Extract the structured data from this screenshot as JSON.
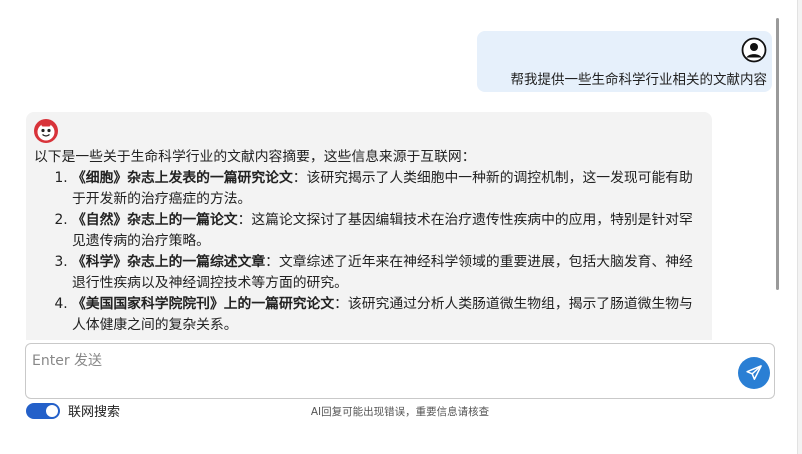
{
  "conversation": {
    "user_message": "帮我提供一些生命科学行业相关的文献内容",
    "bot_intro": "以下是一些关于生命科学行业的文献内容摘要，这些信息来源于互联网：",
    "bot_items": [
      {
        "title": "《细胞》杂志上发表的一篇研究论文",
        "text": "：该研究揭示了人类细胞中一种新的调控机制，这一发现可能有助于开发新的治疗癌症的方法。"
      },
      {
        "title": "《自然》杂志上的一篇论文",
        "text": "：这篇论文探讨了基因编辑技术在治疗遗传性疾病中的应用，特别是针对罕见遗传病的治疗策略。"
      },
      {
        "title": "《科学》杂志上的一篇综述文章",
        "text": "：文章综述了近年来在神经科学领域的重要进展，包括大脑发育、神经退行性疾病以及神经调控技术等方面的研究。"
      },
      {
        "title": "《美国国家科学院院刊》上的一篇研究论文",
        "text": "：该研究通过分析人类肠道微生物组，揭示了肠道微生物与人体健康之间的复杂关系。"
      }
    ]
  },
  "composer": {
    "placeholder": "Enter 发送",
    "value": ""
  },
  "web_search": {
    "label": "联网搜索",
    "enabled": true
  },
  "disclaimer": "AI回复可能出现错误，重要信息请核查",
  "icons": {
    "user_avatar": "user-circle-icon",
    "bot_avatar": "bot-face-icon",
    "send": "send-paper-plane-icon"
  },
  "colors": {
    "user_bubble": "#e6f0fb",
    "bot_bubble": "#f3f3f3",
    "accent": "#2a7fd4",
    "toggle_on": "#2460c9",
    "bot_avatar_red": "#d8333a"
  }
}
